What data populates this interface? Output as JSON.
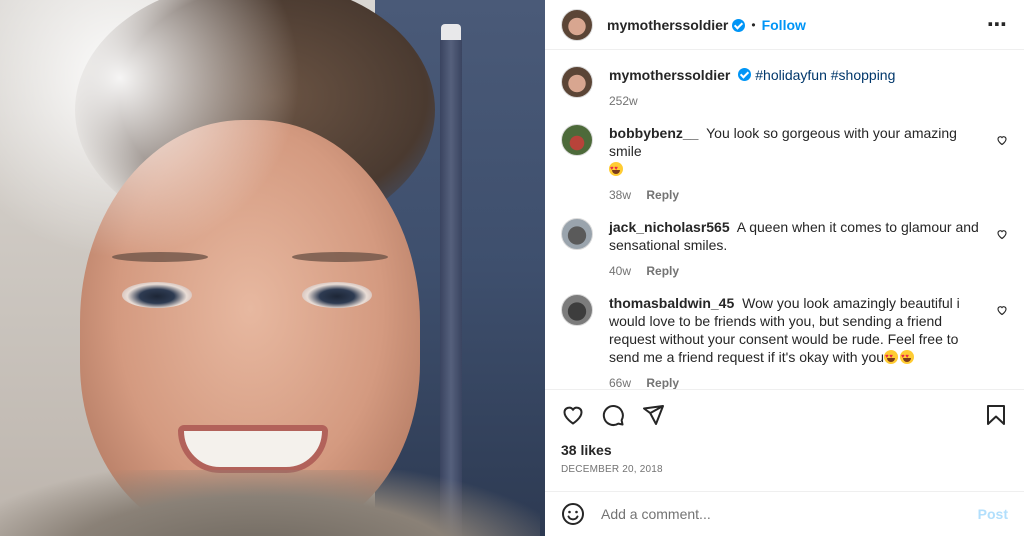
{
  "post": {
    "author": "mymotherssoldier",
    "follow_label": "Follow",
    "separator": "•",
    "more_icon": "⋯",
    "caption": {
      "username": "mymotherssoldier",
      "text": "#holidayfun #shopping",
      "time": "252w"
    },
    "comments": [
      {
        "username": "bobbybenz__",
        "text": "You look so gorgeous with your amazing smile",
        "emoji_count": 1,
        "time": "38w",
        "reply_label": "Reply"
      },
      {
        "username": "jack_nicholasr565",
        "text": "A queen when it comes to glamour and sensational smiles.",
        "emoji_count": 0,
        "time": "40w",
        "reply_label": "Reply"
      },
      {
        "username": "thomasbaldwin_45",
        "text": "Wow you look amazingly beautiful i would love to be friends with you, but sending a friend request without your consent would be rude. Feel free to send me a friend request if it's okay with you",
        "emoji_count": 2,
        "time": "66w",
        "reply_label": "Reply"
      }
    ],
    "likes": "38 likes",
    "date": "DECEMBER 20, 2018",
    "add_comment_placeholder": "Add a comment...",
    "post_label": "Post"
  },
  "colors": {
    "accent": "#0095f6",
    "post_disabled": "#b2dffc",
    "muted": "#737373"
  },
  "icons": {
    "like": "heart-icon",
    "comment": "comment-icon",
    "share": "paper-plane-icon",
    "save": "bookmark-icon",
    "emoji": "smiley-icon",
    "verified": "verified-badge-icon"
  }
}
